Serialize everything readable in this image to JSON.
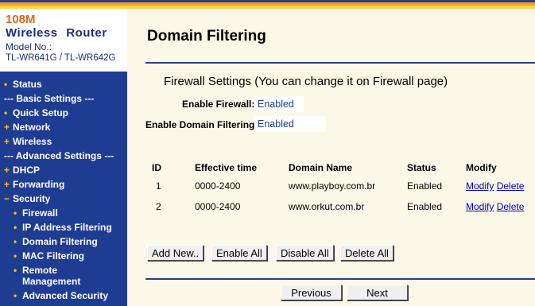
{
  "brand": {
    "speed": "108M",
    "name": "Wireless Router",
    "model_label": "Model No.:",
    "model": "TL-WR641G / TL-WR642G"
  },
  "menu": [
    {
      "label": "Status",
      "bullet": "•",
      "type": "item"
    },
    {
      "label": "--- Basic Settings ---",
      "bullet": "",
      "type": "section"
    },
    {
      "label": "Quick Setup",
      "bullet": "•",
      "type": "item"
    },
    {
      "label": "Network",
      "bullet": "+",
      "type": "item"
    },
    {
      "label": "Wireless",
      "bullet": "+",
      "type": "item"
    },
    {
      "label": "--- Advanced Settings ---",
      "bullet": "",
      "type": "section"
    },
    {
      "label": "DHCP",
      "bullet": "+",
      "type": "item"
    },
    {
      "label": "Forwarding",
      "bullet": "+",
      "type": "item"
    },
    {
      "label": "Security",
      "bullet": "−",
      "type": "item"
    },
    {
      "label": "Firewall",
      "bullet": "•",
      "type": "sub"
    },
    {
      "label": "IP Address Filtering",
      "bullet": "•",
      "type": "sub"
    },
    {
      "label": "Domain Filtering",
      "bullet": "•",
      "type": "sub"
    },
    {
      "label": "MAC Filtering",
      "bullet": "•",
      "type": "sub"
    },
    {
      "label": "Remote Management",
      "bullet": "•",
      "type": "sub"
    },
    {
      "label": "Advanced Security",
      "bullet": "•",
      "type": "sub"
    }
  ],
  "page": {
    "title": "Domain Filtering",
    "firewall_heading": "Firewall Settings (You can change it on Firewall page)",
    "enable_firewall_label": "Enable Firewall:",
    "enable_firewall_value": "Enabled",
    "enable_domain_label": "Enable Domain Filtering:",
    "enable_domain_value": "Enabled"
  },
  "table": {
    "headers": [
      "ID",
      "Effective time",
      "Domain Name",
      "Status",
      "Modify"
    ],
    "rows": [
      {
        "id": "1",
        "time": "0000-2400",
        "domain": "www.playboy.com.br",
        "status": "Enabled",
        "modify": "Modify",
        "delete": "Delete"
      },
      {
        "id": "2",
        "time": "0000-2400",
        "domain": "www.orkut.com.br",
        "status": "Enabled",
        "modify": "Modify",
        "delete": "Delete"
      }
    ]
  },
  "buttons": {
    "add_new": "Add New..",
    "enable_all": "Enable All",
    "disable_all": "Disable All",
    "delete_all": "Delete All",
    "previous": "Previous",
    "next": "Next"
  },
  "colors": {
    "sidebar_bg": "#1f3c93",
    "content_bg": "#fbf8e8",
    "accent_orange": "#e2661a",
    "bullet_yellow": "#ffc400",
    "link_blue": "#0000cc"
  }
}
